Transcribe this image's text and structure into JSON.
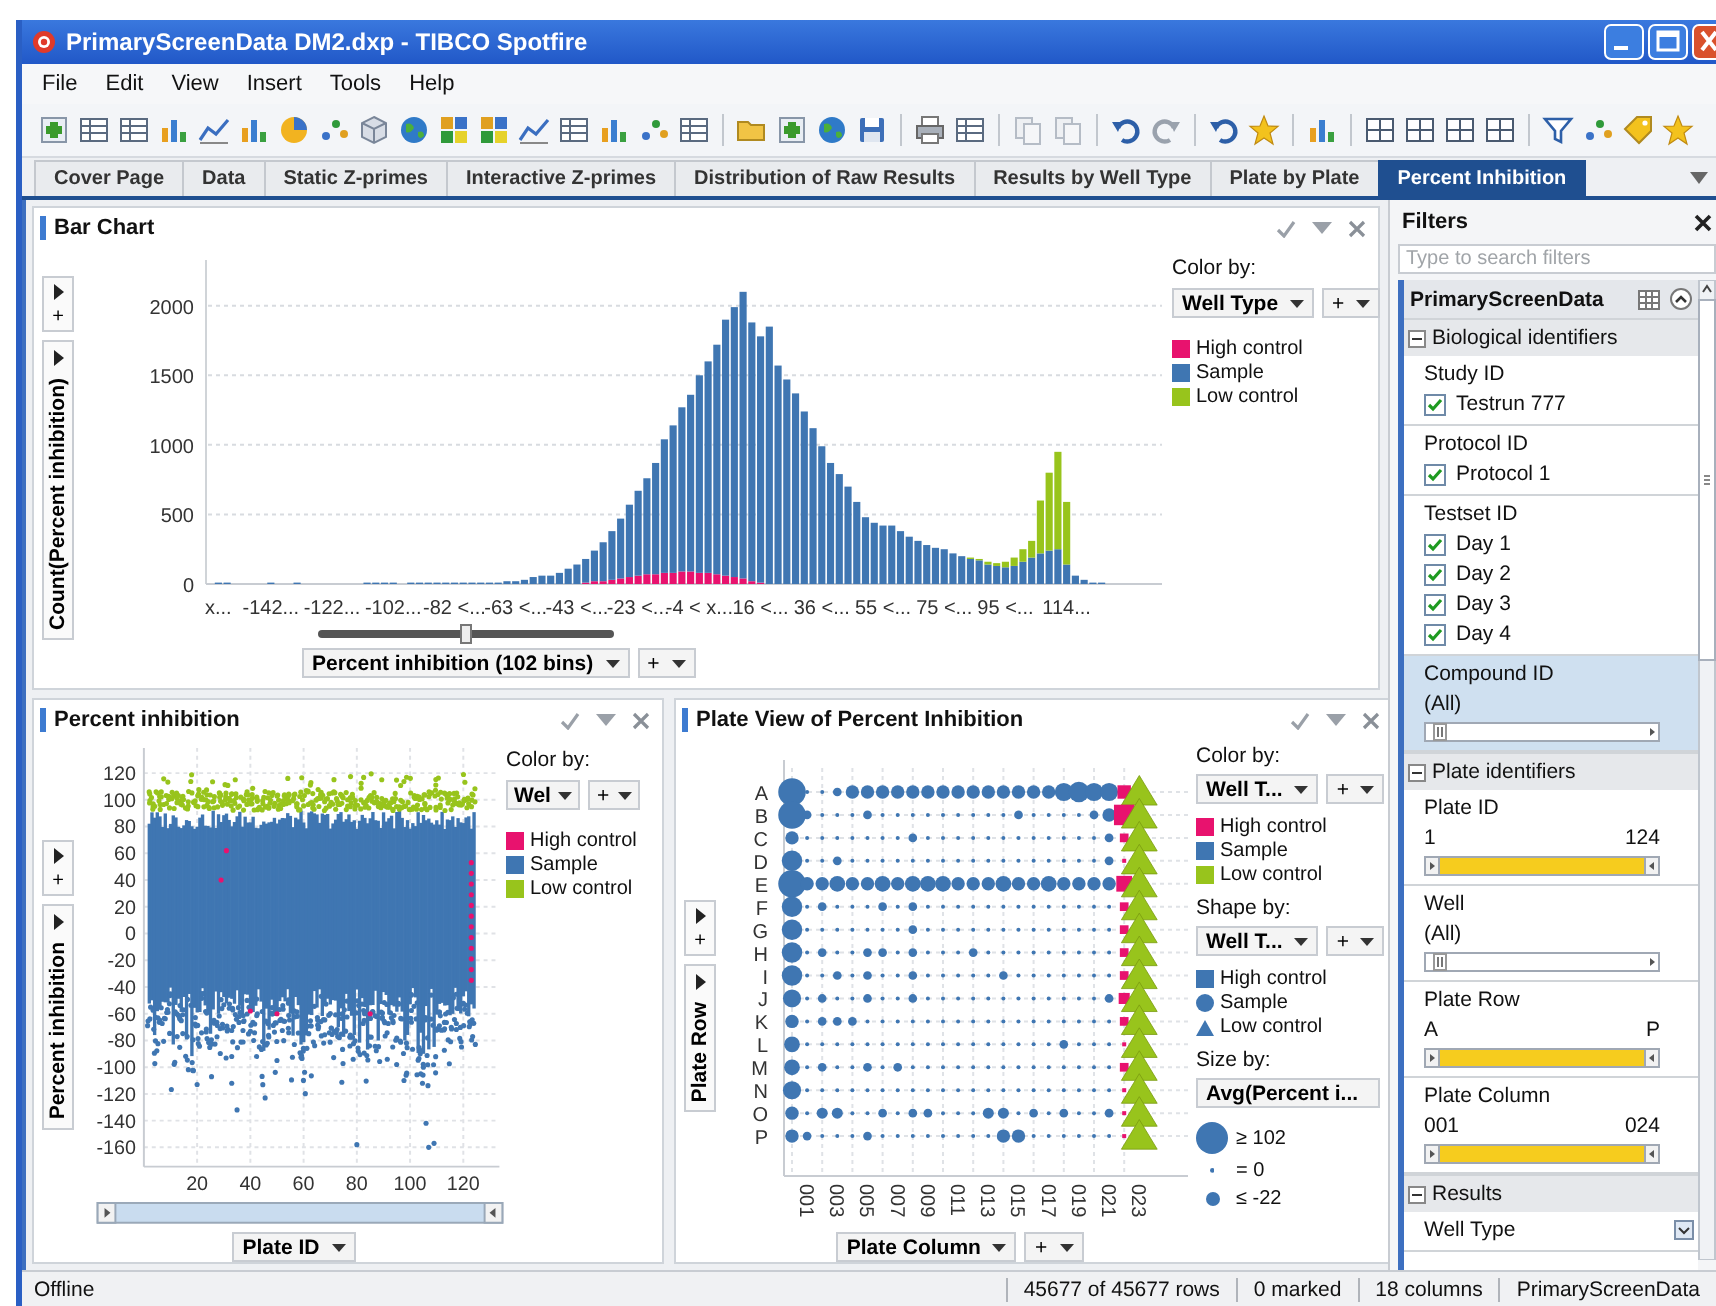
{
  "window": {
    "title": "PrimaryScreenData DM2.dxp - TIBCO Spotfire"
  },
  "menu": [
    "File",
    "Edit",
    "View",
    "Insert",
    "Tools",
    "Help"
  ],
  "tabs": [
    {
      "label": "Cover Page",
      "selected": false
    },
    {
      "label": "Data",
      "selected": false
    },
    {
      "label": "Static Z-primes",
      "selected": false
    },
    {
      "label": "Interactive Z-primes",
      "selected": false
    },
    {
      "label": "Distribution of Raw Results",
      "selected": false
    },
    {
      "label": "Results by Well Type",
      "selected": false
    },
    {
      "label": "Plate by Plate",
      "selected": false
    },
    {
      "label": "Percent Inhibition",
      "selected": true
    }
  ],
  "bar_chart": {
    "title": "Bar Chart",
    "add": "+",
    "x_axis_add": "+",
    "bins_slider": {
      "level": 0.5
    },
    "color_by": {
      "label": "Color by:",
      "value": "Well Type",
      "add": "+"
    },
    "chart_data": {
      "type": "bar",
      "stacked": true,
      "grid": true,
      "ylabel": "Count(Percent inhibition)",
      "xlabel": "Percent inhibition (102 bins)",
      "ylim": [
        0,
        2300
      ],
      "yticks": [
        0,
        500,
        1000,
        1500,
        2000
      ],
      "categories": [
        "x...",
        null,
        null,
        null,
        null,
        null,
        "-142...",
        null,
        null,
        null,
        null,
        null,
        null,
        "-122...",
        null,
        null,
        null,
        null,
        null,
        null,
        "-102...",
        null,
        null,
        null,
        null,
        null,
        null,
        "-82 <...",
        null,
        null,
        null,
        null,
        null,
        null,
        "-63 <...",
        null,
        null,
        null,
        null,
        null,
        null,
        "-43 <...",
        null,
        null,
        null,
        null,
        null,
        null,
        "-23 <...",
        null,
        null,
        null,
        null,
        null,
        null,
        "-4 < x...",
        null,
        null,
        null,
        null,
        null,
        null,
        "16 <...",
        null,
        null,
        null,
        null,
        null,
        null,
        "36 <...",
        null,
        null,
        null,
        null,
        null,
        null,
        "55 <...",
        null,
        null,
        null,
        null,
        null,
        null,
        "75 <...",
        null,
        null,
        null,
        null,
        null,
        null,
        "95 <...",
        null,
        null,
        null,
        null,
        null,
        null,
        "114...",
        null,
        null,
        null,
        null
      ],
      "series": [
        {
          "name": "High control",
          "color": "#e8126e",
          "values": [
            0,
            0,
            0,
            0,
            0,
            0,
            0,
            0,
            0,
            0,
            0,
            0,
            0,
            0,
            0,
            0,
            0,
            0,
            0,
            0,
            0,
            0,
            0,
            0,
            0,
            0,
            0,
            0,
            0,
            0,
            0,
            0,
            0,
            0,
            0,
            0,
            0,
            0,
            0,
            0,
            0,
            0,
            10,
            20,
            20,
            30,
            40,
            50,
            60,
            70,
            70,
            80,
            80,
            90,
            90,
            80,
            80,
            70,
            60,
            50,
            40,
            20,
            10,
            0,
            0,
            0,
            0,
            0,
            0,
            0,
            0,
            0,
            0,
            0,
            0,
            0,
            0,
            0,
            0,
            0,
            0,
            0,
            0,
            0,
            0,
            0,
            0,
            0,
            0,
            0,
            0,
            0,
            0,
            0,
            0,
            0,
            0,
            0,
            0,
            0,
            0,
            0
          ]
        },
        {
          "name": "Sample",
          "color": "#3f76b2",
          "values": [
            10,
            10,
            0,
            0,
            0,
            0,
            10,
            0,
            0,
            10,
            0,
            0,
            0,
            0,
            0,
            0,
            0,
            10,
            10,
            10,
            10,
            0,
            10,
            10,
            10,
            10,
            10,
            10,
            10,
            10,
            10,
            10,
            10,
            20,
            20,
            30,
            50,
            60,
            60,
            80,
            110,
            140,
            170,
            220,
            280,
            350,
            430,
            520,
            610,
            690,
            800,
            960,
            1060,
            1180,
            1270,
            1420,
            1520,
            1650,
            1840,
            1940,
            2060,
            1860,
            1770,
            1850,
            1570,
            1470,
            1370,
            1240,
            1120,
            990,
            870,
            790,
            700,
            590,
            480,
            440,
            420,
            420,
            380,
            340,
            310,
            280,
            260,
            250,
            220,
            200,
            180,
            170,
            140,
            130,
            120,
            130,
            160,
            190,
            220,
            240,
            250,
            140,
            60,
            30,
            10,
            10
          ]
        },
        {
          "name": "Low control",
          "color": "#98c41c",
          "values": [
            0,
            0,
            0,
            0,
            0,
            0,
            0,
            0,
            0,
            0,
            0,
            0,
            0,
            0,
            0,
            0,
            0,
            0,
            0,
            0,
            0,
            0,
            0,
            0,
            0,
            0,
            0,
            0,
            0,
            0,
            0,
            0,
            0,
            0,
            0,
            0,
            0,
            0,
            0,
            0,
            0,
            0,
            0,
            0,
            0,
            0,
            0,
            0,
            0,
            0,
            0,
            0,
            0,
            0,
            0,
            0,
            0,
            0,
            0,
            0,
            0,
            0,
            0,
            0,
            0,
            0,
            0,
            0,
            0,
            0,
            0,
            0,
            0,
            0,
            0,
            0,
            0,
            0,
            0,
            0,
            0,
            0,
            0,
            0,
            0,
            0,
            10,
            10,
            20,
            20,
            40,
            60,
            90,
            120,
            380,
            560,
            700,
            450,
            0,
            0,
            0,
            0
          ]
        }
      ]
    }
  },
  "scatter": {
    "title": "Percent inhibition",
    "add": "+",
    "y_axis_selector": "Percent inhibition",
    "x_axis_selector": "Plate ID",
    "color_by": {
      "label": "Color by:",
      "value": "Wel",
      "add": "+"
    },
    "legend": [
      {
        "name": "High control",
        "color": "#e8126e"
      },
      {
        "name": "Sample",
        "color": "#3f76b2"
      },
      {
        "name": "Low control",
        "color": "#98c41c"
      }
    ],
    "y_ticks": [
      "120",
      "100",
      "80",
      "60",
      "40",
      "20",
      "0",
      "-20",
      "-40",
      "-60",
      "-80",
      "-100",
      "-120",
      "-140",
      "-160"
    ],
    "x_ticks": [
      "20",
      "40",
      "60",
      "80",
      "100",
      "120"
    ]
  },
  "plate_view": {
    "title": "Plate View of Percent Inhibition",
    "add": "+",
    "y_axis_selector": "Plate Row",
    "x_axis_selector": "Plate Column",
    "x_axis_add": "+",
    "row_labels": [
      "A",
      "B",
      "C",
      "D",
      "E",
      "F",
      "G",
      "H",
      "I",
      "J",
      "K",
      "L",
      "M",
      "N",
      "O",
      "P"
    ],
    "column_labels": [
      "001",
      "003",
      "005",
      "007",
      "009",
      "011",
      "013",
      "015",
      "017",
      "019",
      "021",
      "023"
    ],
    "color_by": {
      "label": "Color by:",
      "value": "Well T...",
      "add": "+"
    },
    "color_legend": [
      {
        "name": "High control",
        "color": "#e8126e"
      },
      {
        "name": "Sample",
        "color": "#3f76b2"
      },
      {
        "name": "Low control",
        "color": "#98c41c"
      }
    ],
    "shape_by": {
      "label": "Shape by:",
      "value": "Well T...",
      "add": "+"
    },
    "shape_legend": [
      {
        "name": "High control",
        "kind": "square"
      },
      {
        "name": "Sample",
        "kind": "circle"
      },
      {
        "name": "Low control",
        "kind": "triangle"
      }
    ],
    "size_by": {
      "label": "Size by:",
      "value": "Avg(Percent i..."
    },
    "size_legend": [
      {
        "label": "≥ 102",
        "kind": "large"
      },
      {
        "label": "= 0",
        "kind": "tiny"
      },
      {
        "label": "≤ -22",
        "kind": "medium"
      }
    ]
  },
  "filters": {
    "title": "Filters",
    "search_placeholder": "Type to search filters",
    "table": "PrimaryScreenData",
    "groups": [
      {
        "label": "Biological identifiers",
        "expanded": true,
        "filters": [
          {
            "kind": "checkbox",
            "label": "Study ID",
            "selected": false,
            "options": [
              {
                "label": "Testrun 777",
                "checked": true
              }
            ]
          },
          {
            "kind": "checkbox",
            "label": "Protocol ID",
            "selected": false,
            "options": [
              {
                "label": "Protocol 1",
                "checked": true
              }
            ]
          },
          {
            "kind": "checkbox",
            "label": "Testset ID",
            "selected": false,
            "options": [
              {
                "label": "Day 1",
                "checked": true
              },
              {
                "label": "Day 2",
                "checked": true
              },
              {
                "label": "Day 3",
                "checked": true
              },
              {
                "label": "Day 4",
                "checked": true
              }
            ]
          },
          {
            "kind": "list",
            "label": "Compound ID",
            "value": "(All)",
            "selected": true
          }
        ]
      },
      {
        "label": "Plate identifiers",
        "expanded": true,
        "filters": [
          {
            "kind": "range",
            "label": "Plate ID",
            "min": "1",
            "max": "124",
            "selected": false
          },
          {
            "kind": "list",
            "label": "Well",
            "value": "(All)",
            "selected": false
          },
          {
            "kind": "range",
            "label": "Plate Row",
            "min": "A",
            "max": "P",
            "selected": false
          },
          {
            "kind": "range",
            "label": "Plate Column",
            "min": "001",
            "max": "024",
            "selected": false
          }
        ]
      },
      {
        "label": "Results",
        "expanded": true,
        "filters": [
          {
            "kind": "collapsed",
            "label": "Well Type",
            "selected": false
          }
        ]
      }
    ]
  },
  "status_bar": {
    "state": "Offline",
    "rows": "45677 of 45677 rows",
    "marked": "0 marked",
    "columns": "18 columns",
    "table": "PrimaryScreenData"
  }
}
